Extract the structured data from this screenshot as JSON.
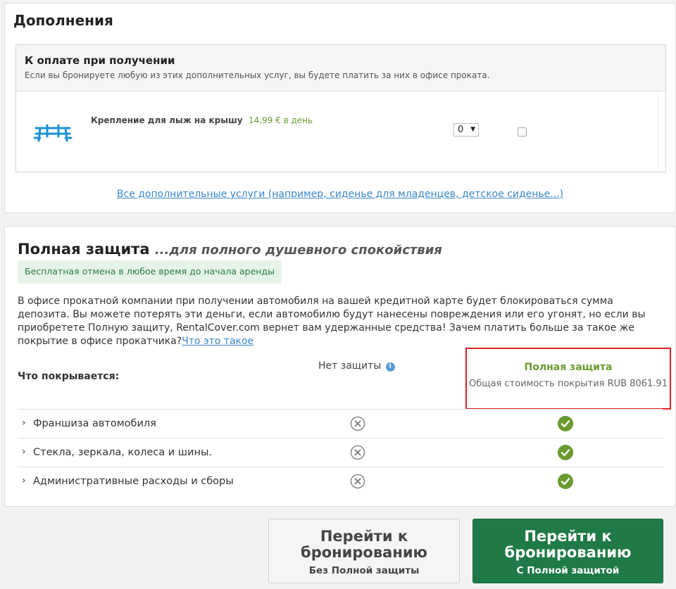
{
  "extras": {
    "title": "Дополнения",
    "pay_box": {
      "title": "К оплате при получении",
      "desc": "Если вы бронируете любую из этих дополнительных услуг, вы будете платить за них в офисе проката."
    },
    "item": {
      "icon": "ski-rack-icon",
      "name": "Крепление для лыж на крышу",
      "price": "14,99 € в день",
      "qty": "0",
      "qty_arrow": "▼"
    },
    "link": "Все дополнительные услуги  (например, сиденье для младенцев, детское сиденье...)"
  },
  "protection": {
    "title": "Полная защита",
    "subtitle": "...для полного душевного спокойствия",
    "free_cancel": "Бесплатная отмена в любое время до начала аренды",
    "desc": "В офисе прокатной компании при получении автомобиля на вашей кредитной карте будет блокироваться сумма депозита. Вы можете потерять эти деньги, если автомобилю будут нанесены повреждения или его угонят, но если вы приобретете Полную защиту, RentalCover.com вернет вам удержанные средства! Зачем платить больше за такое же покрытие в офисе прокатчика?",
    "what_link": "Что это такое",
    "covered_label": "Что покрывается:",
    "no_protection": "Нет защиты",
    "info_glyph": "i",
    "full_title": "Полная защита",
    "full_cost": "Общая стоимость покрытия RUB 8061.91",
    "rows": [
      {
        "name": "Франшиза автомобиля"
      },
      {
        "name": "Стекла, зеркала, колеса и шины."
      },
      {
        "name": "Административные расходы и сборы"
      }
    ],
    "chevron": "›"
  },
  "buttons": {
    "no": {
      "main": "Перейти к бронированию",
      "sub": "Без Полной защиты"
    },
    "yes": {
      "main": "Перейти к бронированию",
      "sub": "С Полной защитой"
    }
  },
  "colors": {
    "accent_green": "#6a9a2f",
    "button_green": "#1f7a47",
    "highlight_red": "#e01f1f",
    "link_blue": "#3a87c8"
  }
}
